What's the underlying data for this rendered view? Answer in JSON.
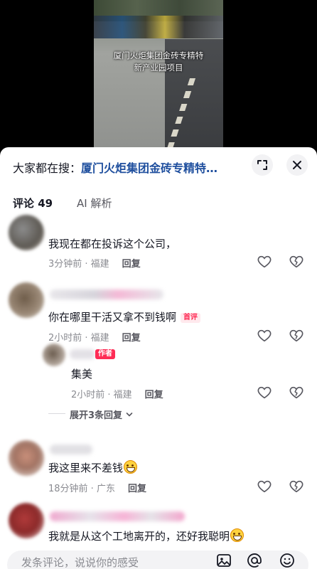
{
  "video": {
    "caption_line1": "厦门火炬集团金砖专精特",
    "caption_line2": "新产业园项目"
  },
  "panel": {
    "search_prefix": "大家都在搜：",
    "search_term": "厦门火炬集团金砖专精特…",
    "tabs": [
      {
        "label": "评论 49",
        "active": true
      },
      {
        "label": "AI 解析",
        "active": false
      }
    ]
  },
  "comments": [
    {
      "text": "我现在都在投诉这个公司，",
      "time": "3分钟前 · 福建",
      "reply": "回复"
    },
    {
      "text": "你在哪里干活又拿不到钱啊",
      "badge": "首评",
      "time": "2小时前 · 福建",
      "reply": "回复"
    },
    {
      "text": "集美",
      "author_badge": "作者",
      "time": "2小时前 · 福建",
      "reply": "回复",
      "expand": "展开3条回复"
    },
    {
      "text": "我这里来不差钱",
      "time": "18分钟前 · 广东",
      "reply": "回复"
    },
    {
      "text": "我就是从这个工地离开的，还好我聪明"
    }
  ],
  "input": {
    "placeholder": "发条评论，说说你的感受"
  },
  "icons": {
    "fullscreen": "expand-icon",
    "close": "close-icon",
    "like": "heart-icon",
    "dislike": "broken-heart-icon",
    "image": "image-icon",
    "mention": "at-icon",
    "emoji": "emoji-icon"
  },
  "colors": {
    "search_term": "#1f4f9e",
    "badge": "#fe2c55"
  }
}
